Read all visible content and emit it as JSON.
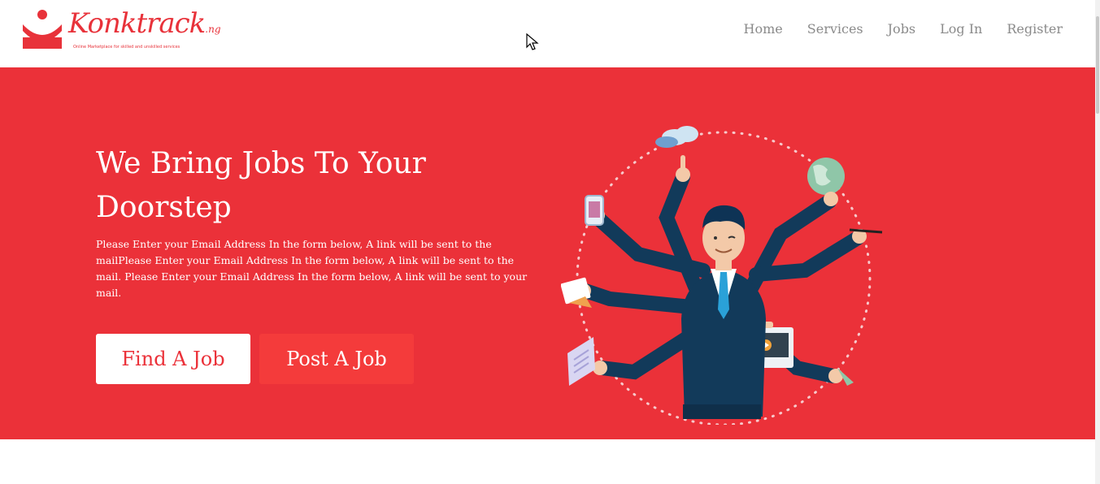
{
  "brand": {
    "name": "Konktrack",
    "tld": ".ng",
    "tagline": "Online Marketplace for skilled and unskilled services",
    "color": "#e8323a"
  },
  "nav": {
    "items": [
      "Home",
      "Services",
      "Jobs",
      "Log In",
      "Register"
    ]
  },
  "hero": {
    "title": "We Bring Jobs To Your Doorstep",
    "description": "Please Enter your Email Address In the form below, A link will be sent to the mailPlease Enter your Email Address In the form below, A link will be sent to the mail. Please Enter your Email Address In the form below, A link will be sent to your mail.",
    "find_label": "Find A Job",
    "post_label": "Post A Job",
    "background": "#eb3139"
  }
}
